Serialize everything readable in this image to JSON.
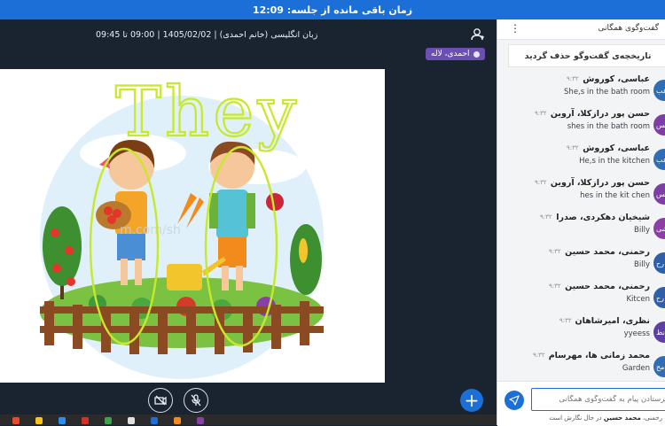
{
  "top_bar": {
    "timer_text": "زمان باقی مانده از جلسه: 12:09"
  },
  "session": {
    "info": "زبان انگلیسی (خانم احمدی) | 1405/02/02 | 09:00 تا 09:45",
    "presenter": "احمدی، لاله"
  },
  "slide": {
    "handwriting": "They",
    "watermark": "m.com/sh"
  },
  "chat": {
    "title": "گفت‌وگوی همگانی",
    "cleared_notice": "تاریخچه‌ی گفت‌وگو حذف گردید",
    "messages": [
      {
        "name": "عباسی، کوروش",
        "time": "۹:۳۲",
        "text": "She,s in the bath room",
        "avatar": "عب",
        "color": "#2f6db5"
      },
      {
        "name": "حسن پور درازکلا، آروین",
        "time": "۹:۳۲",
        "text": "shes in the bath room",
        "avatar": "حس",
        "color": "#7d3fa6"
      },
      {
        "name": "عباسی، کوروش",
        "time": "۹:۳۲",
        "text": "He,s in the kitchen",
        "avatar": "عب",
        "color": "#2f6db5"
      },
      {
        "name": "حسن پور درازکلا، آروین",
        "time": "۹:۳۲",
        "text": "hes in the kit chen",
        "avatar": "حس",
        "color": "#7d3fa6"
      },
      {
        "name": "شیخیان دهکردی، صدرا",
        "time": "۹:۳۲",
        "text": "Billy",
        "avatar": "شی",
        "color": "#8a3fa6"
      },
      {
        "name": "رحمنی، محمد حسین",
        "time": "۹:۳۲",
        "text": "Billy",
        "avatar": "رح",
        "color": "#2f5fa8"
      },
      {
        "name": "رحمنی، محمد حسین",
        "time": "۹:۳۲",
        "text": "Kitcen",
        "avatar": "رح",
        "color": "#2f5fa8"
      },
      {
        "name": "نظری، امیرشاهان",
        "time": "۹:۳۲",
        "text": "yyeess",
        "avatar": "نظ",
        "color": "#5e3fa6"
      },
      {
        "name": "محمد زمانی ها، مهرسام",
        "time": "۹:۳۲",
        "text": "Garden",
        "avatar": "مح",
        "color": "#2f6db5"
      }
    ],
    "input_placeholder": "فرستادن پیام به گفت‌وگوی همگانی",
    "typing_name": "محمد حسین",
    "typing_prefix": "رحمنی،",
    "typing_suffix": "در حال نگارش است"
  },
  "icons": {
    "user": "user-settings-icon",
    "camera_off": "camera-off-icon",
    "mic_off": "mic-off-icon",
    "plus": "plus-icon",
    "send": "send-icon",
    "menu": "kebab-menu-icon"
  },
  "colors": {
    "accent": "#1b6fd6",
    "dark_bg": "#1a2431",
    "presenter_tag": "#6b4fb3",
    "annotation": "#c8e82a"
  }
}
